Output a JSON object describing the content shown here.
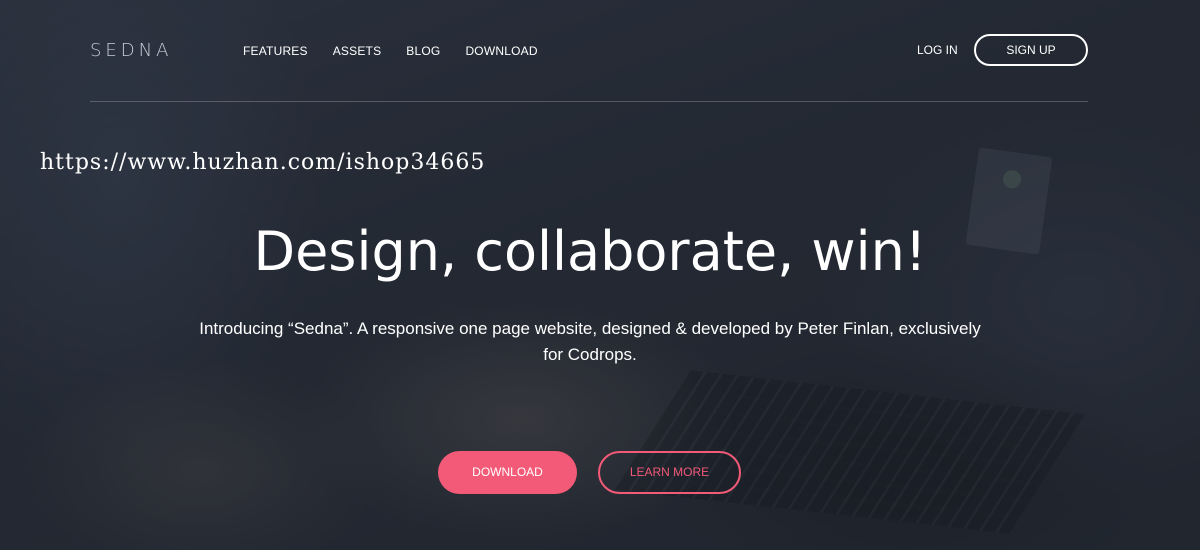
{
  "brand": {
    "logo": "SEDNA"
  },
  "nav": {
    "items": [
      {
        "label": "FEATURES"
      },
      {
        "label": "ASSETS"
      },
      {
        "label": "BLOG"
      },
      {
        "label": "DOWNLOAD"
      }
    ],
    "login_label": "LOG IN",
    "signup_label": "SIGN UP"
  },
  "watermark": {
    "text": "https://www.huzhan.com/ishop34665"
  },
  "hero": {
    "title": "Design, collaborate, win!",
    "subtitle": "Introducing “Sedna”. A responsive one page website, designed & developed by Peter Finlan, exclusively for Codrops.",
    "primary_button": "DOWNLOAD",
    "secondary_button": "LEARN MORE"
  },
  "colors": {
    "accent": "#f25a78",
    "text": "#ffffff",
    "overlay": "#2a2f3a"
  }
}
